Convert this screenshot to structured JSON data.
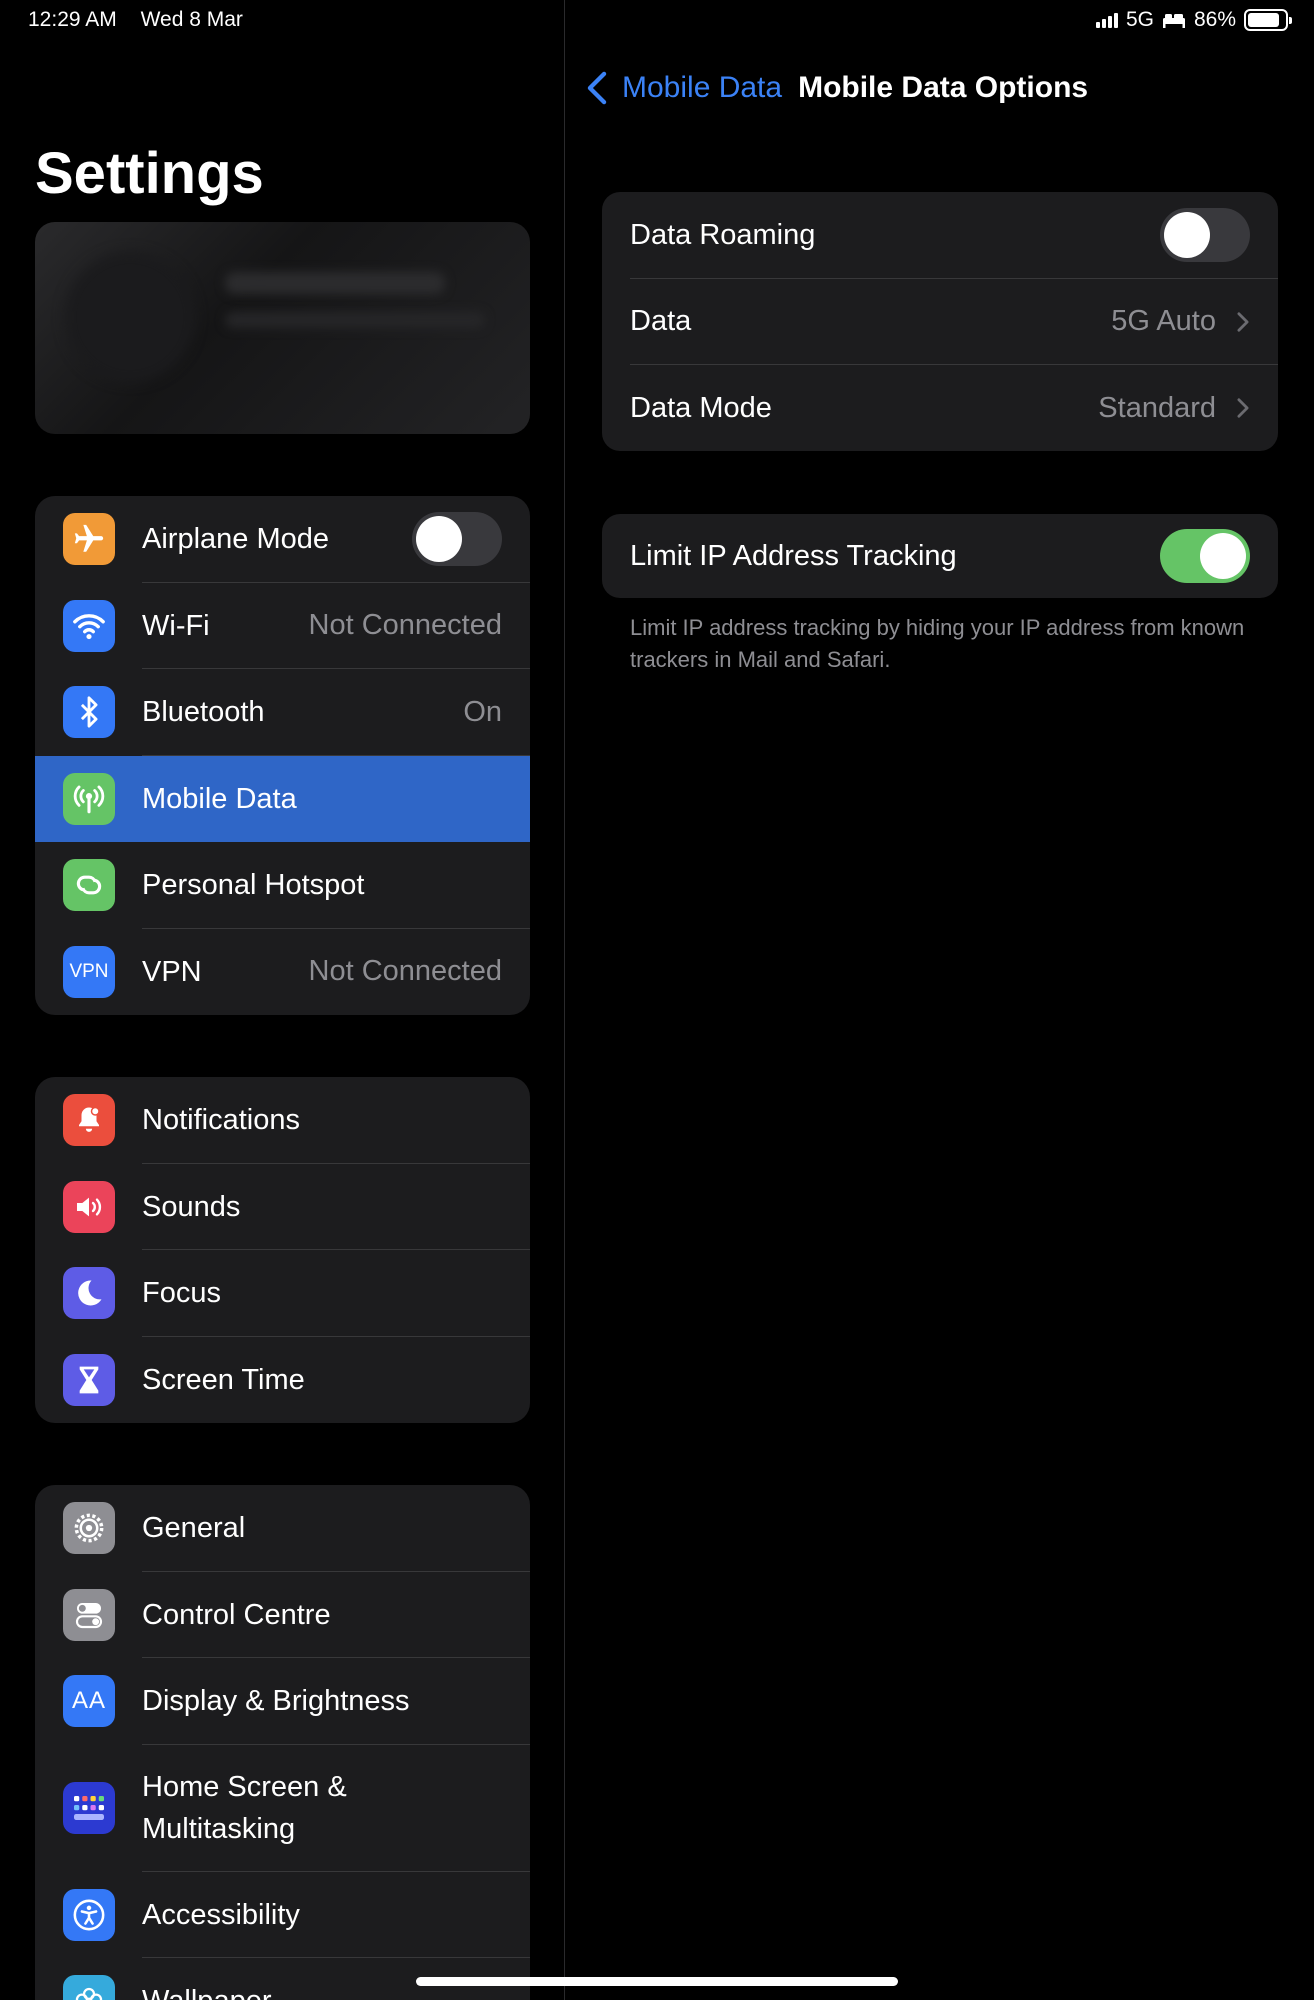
{
  "status_bar": {
    "time": "12:29 AM",
    "date": "Wed 8 Mar",
    "network": "5G",
    "battery": "86%",
    "battery_level": 0.86
  },
  "sidebar": {
    "title": "Settings",
    "group1": [
      {
        "label": "Airplane Mode",
        "icon": "airplane-icon",
        "color": "#f19a37",
        "toggle": false
      },
      {
        "label": "Wi-Fi",
        "value": "Not Connected",
        "icon": "wifi-icon",
        "color": "#3478f6"
      },
      {
        "label": "Bluetooth",
        "value": "On",
        "icon": "bluetooth-icon",
        "color": "#3478f6"
      },
      {
        "label": "Mobile Data",
        "icon": "antenna-icon",
        "color": "#65c466",
        "selected": true
      },
      {
        "label": "Personal Hotspot",
        "icon": "hotspot-icon",
        "color": "#65c466"
      },
      {
        "label": "VPN",
        "value": "Not Connected",
        "icon": "vpn-icon",
        "color": "#3478f6",
        "icon_text": "VPN"
      }
    ],
    "group2": [
      {
        "label": "Notifications",
        "icon": "bell-icon",
        "color": "#eb4e3d"
      },
      {
        "label": "Sounds",
        "icon": "speaker-icon",
        "color": "#eb445a"
      },
      {
        "label": "Focus",
        "icon": "moon-icon",
        "color": "#5e5ce6"
      },
      {
        "label": "Screen Time",
        "icon": "hourglass-icon",
        "color": "#5e5ce6"
      }
    ],
    "group3": [
      {
        "label": "General",
        "icon": "gear-icon",
        "color": "#8e8e93"
      },
      {
        "label": "Control Centre",
        "icon": "switches-icon",
        "color": "#8e8e93"
      },
      {
        "label": "Display & Brightness",
        "icon": "text-size-icon",
        "color": "#3478f6",
        "icon_text": "AA"
      },
      {
        "label": "Home Screen &\nMultitasking",
        "icon": "grid-icon",
        "color": "#2c3ad1"
      },
      {
        "label": "Accessibility",
        "icon": "accessibility-icon",
        "color": "#3478f6"
      },
      {
        "label": "Wallpaper",
        "icon": "flower-icon",
        "color": "#35aadc"
      }
    ]
  },
  "detail": {
    "back_label": "Mobile Data",
    "title": "Mobile Data Options",
    "group1": [
      {
        "label": "Data Roaming",
        "toggle": false
      },
      {
        "label": "Data",
        "value": "5G Auto"
      },
      {
        "label": "Data Mode",
        "value": "Standard"
      }
    ],
    "group2": [
      {
        "label": "Limit IP Address Tracking",
        "toggle": true
      }
    ],
    "footnote": "Limit IP address tracking by hiding your IP address from known trackers in Mail and Safari."
  }
}
